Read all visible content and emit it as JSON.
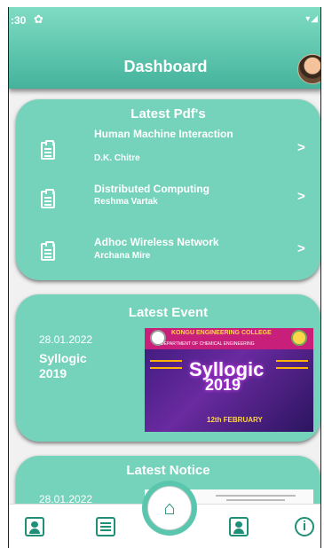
{
  "status_bar": {
    "time": ":30",
    "gear_icon": "gear-icon",
    "signal_icons": "▾◢"
  },
  "header": {
    "title": "Dashboard",
    "avatar_icon": "avatar"
  },
  "latest_pdfs": {
    "title": "Latest Pdf's",
    "items": [
      {
        "title": "Human Machine Interaction",
        "author": "D.K. Chitre"
      },
      {
        "title": "Distributed Computing",
        "author": "Reshma Vartak"
      },
      {
        "title": "Adhoc Wireless Network",
        "author": "Archana Mire"
      }
    ],
    "chevron": ">"
  },
  "latest_event": {
    "title": "Latest Event",
    "date": "28.01.2022",
    "name": "Syllogic 2019",
    "poster": {
      "college": "KONGU ENGINEERING COLLEGE",
      "dept": "DEPARTMENT OF CHEMICAL ENGINEERING",
      "event": "Syllogic",
      "year": "2019",
      "date": "12th FEBRUARY"
    }
  },
  "latest_notice": {
    "title": "Latest Notice",
    "date": "28.01.2022"
  },
  "bottom_nav": {
    "home_glyph": "⌂",
    "info_glyph": "i"
  },
  "colors": {
    "accent": "#75d3bb",
    "header_top": "#7fdcc3",
    "nav_icon": "#1f8f78"
  }
}
